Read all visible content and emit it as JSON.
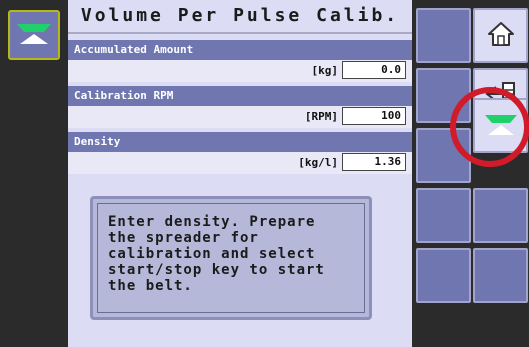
{
  "title": "Volume Per Pulse Calib.",
  "rows": [
    {
      "label": "Accumulated Amount",
      "unit": "[kg]",
      "value": "0.0"
    },
    {
      "label": "Calibration RPM",
      "unit": "[RPM]",
      "value": "100"
    },
    {
      "label": "Density",
      "unit": "[kg/l]",
      "value": "1.36"
    }
  ],
  "message": "Enter density. Prepare\nthe spreader for\ncalibration and select\nstart/stop key to start\nthe belt.",
  "icons": {
    "left": "spreader-icon",
    "home": "home-icon",
    "exit": "exit-icon",
    "spreader": "spreader-icon"
  },
  "colors": {
    "panel": "#dcdcf4",
    "header": "#6f76b0",
    "highlight": "#d11b2b"
  }
}
